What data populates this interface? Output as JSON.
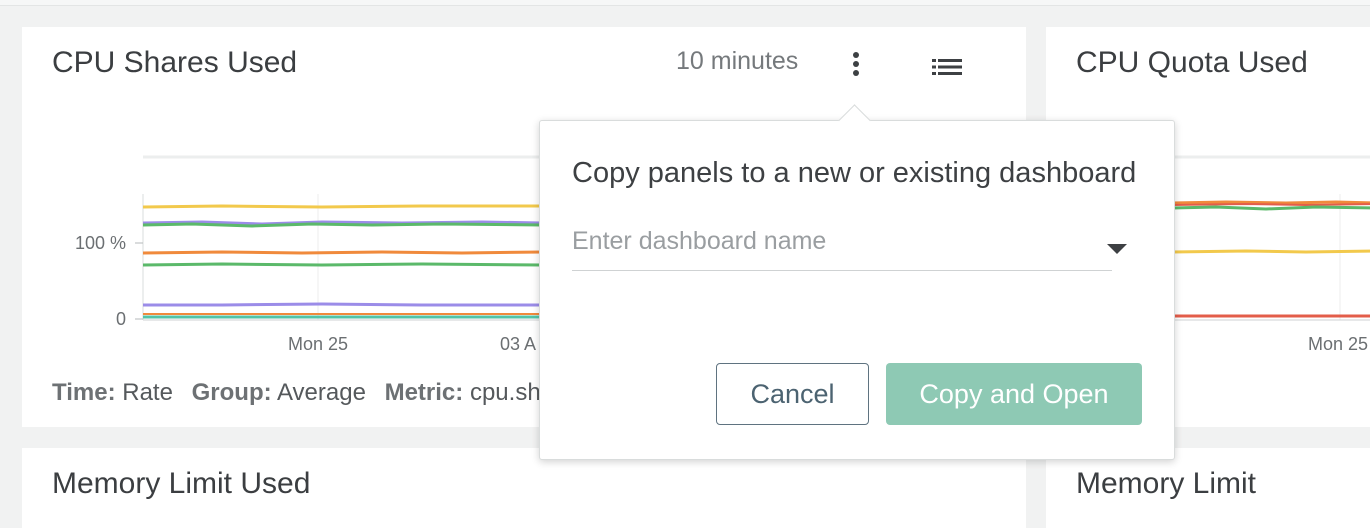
{
  "panels": {
    "cpu_shares": {
      "title": "CPU Shares Used",
      "time_range": "10 minutes",
      "y_ticks": [
        "100 %",
        "0"
      ],
      "x_ticks": [
        "Mon 25",
        "03 A"
      ],
      "footer": {
        "time_label": "Time:",
        "time_value": "Rate",
        "group_label": "Group:",
        "group_value": "Average",
        "metric_label": "Metric:",
        "metric_value": "cpu.sh"
      }
    },
    "cpu_quota": {
      "title": "CPU Quota Used",
      "x_ticks": [
        "Mon 25"
      ]
    },
    "memory_limit_used": {
      "title": "Memory Limit Used"
    },
    "memory_limit": {
      "title": "Memory Limit"
    }
  },
  "popover": {
    "title": "Copy panels to a new or existing dashboard",
    "input_placeholder": "Enter dashboard name",
    "input_value": "",
    "cancel_label": "Cancel",
    "copy_label": "Copy and Open"
  },
  "colors": {
    "yellow": "#f2c94c",
    "purple": "#9b8ce8",
    "green": "#5bb96a",
    "orange": "#f08a3c",
    "red": "#e35d4a",
    "teal": "#52c4a7",
    "copy_button": "#8ec9b4",
    "cancel_border": "#5f7380"
  },
  "icons": {
    "menu": "kebab-vertical-icon",
    "list": "list-icon",
    "dropdown": "caret-down-icon"
  }
}
